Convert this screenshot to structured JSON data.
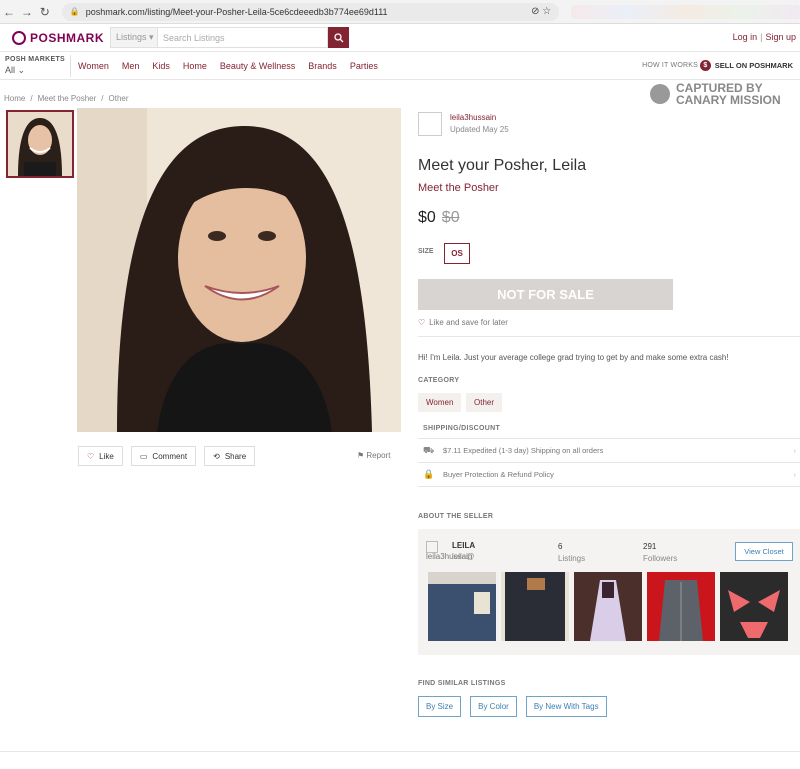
{
  "browser": {
    "url": "poshmark.com/listing/Meet-your-Posher-Leila-5ce6cdeeedb3b774ee69d111",
    "back": "←",
    "forward": "→",
    "reload": "↻",
    "lock": "🔒",
    "icons": "⊘ ☆"
  },
  "header": {
    "logo": "POSHMARK",
    "search_select": "Listings ▾",
    "search_placeholder": "Search Listings",
    "login": "Log in",
    "signup": "Sign up"
  },
  "catbar": {
    "markets_title": "POSH MARKETS",
    "markets_value": "All ⌄",
    "links": [
      "Women",
      "Men",
      "Kids",
      "Home",
      "Beauty & Wellness",
      "Brands",
      "Parties"
    ],
    "how_it_works": "HOW IT WORKS",
    "sell": "SELL ON POSHMARK",
    "sell_icon": "$"
  },
  "breadcrumb": [
    "Home",
    "Meet the Posher",
    "Other"
  ],
  "watermark": {
    "line1": "CAPTURED BY",
    "line2": "CANARY MISSION"
  },
  "actions": {
    "like": "Like",
    "comment": "Comment",
    "share": "Share",
    "report": "Report"
  },
  "listing": {
    "seller": "leila3hussain",
    "updated": "Updated May 25",
    "title": "Meet your Posher, Leila",
    "brand": "Meet the Posher",
    "price": "$0",
    "original_price": "$0",
    "size_label": "SIZE",
    "size": "OS",
    "status": "NOT FOR SALE",
    "like_save": "Like and save for later",
    "description": "Hi! I'm Leila. Just your average college grad trying to get by and make some extra cash!",
    "category_label": "CATEGORY",
    "categories": [
      "Women",
      "Other"
    ],
    "shipping_label": "SHIPPING/DISCOUNT",
    "shipping": "$7.11 Expedited (1-3 day) Shipping on all orders",
    "protection": "Buyer Protection & Refund Policy"
  },
  "about": {
    "label": "ABOUT THE SELLER",
    "name": "LEILA",
    "handle": "leila3hussain",
    "overlay_handle": "leila@",
    "listings_count": "6",
    "listings_label": "Listings",
    "followers_count": "291",
    "followers_label": "Followers",
    "view_closet": "View Closet"
  },
  "similar": {
    "label": "FIND SIMILAR LISTINGS",
    "buttons": [
      "By Size",
      "By Color",
      "By New With Tags"
    ]
  },
  "colors": {
    "brand": "#822432",
    "accent_blue": "#3c7fb2"
  }
}
